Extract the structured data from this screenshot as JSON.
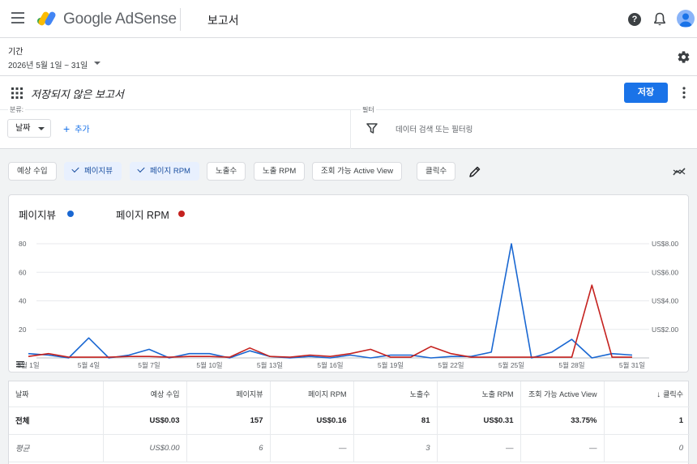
{
  "app": {
    "brand": "Google AdSense",
    "page_title": "보고서"
  },
  "period": {
    "label": "기간",
    "value": "2026년 5월 1일 ~ 31일"
  },
  "report": {
    "title": "저장되지 않은 보고서",
    "save_label": "저장",
    "dimension_label": "분류:",
    "dimension_value": "날짜",
    "add_label": "추가",
    "filter_label": "필터",
    "filter_placeholder": "데이터 검색 또는 필터링"
  },
  "metric_chips": [
    {
      "label": "예상 수입",
      "selected": false
    },
    {
      "label": "페이지뷰",
      "selected": true
    },
    {
      "label": "페이지 RPM",
      "selected": true
    },
    {
      "label": "노출수",
      "selected": false
    },
    {
      "label": "노출 RPM",
      "selected": false
    },
    {
      "label": "조회 가능 Active View",
      "selected": false
    },
    {
      "label": "클릭수",
      "selected": false
    }
  ],
  "colors": {
    "accent": "#1a73e8",
    "series_blue": "#1967d2",
    "series_red": "#c5221f"
  },
  "chart_data": {
    "type": "line",
    "x": [
      "5월 1일",
      "5월 2일",
      "5월 3일",
      "5월 4일",
      "5월 5일",
      "5월 6일",
      "5월 7일",
      "5월 8일",
      "5월 9일",
      "5월 10일",
      "5월 11일",
      "5월 12일",
      "5월 13일",
      "5월 14일",
      "5월 15일",
      "5월 16일",
      "5월 17일",
      "5월 18일",
      "5월 19일",
      "5월 20일",
      "5월 21일",
      "5월 22일",
      "5월 23일",
      "5월 24일",
      "5월 25일",
      "5월 26일",
      "5월 27일",
      "5월 28일",
      "5월 29일",
      "5월 30일",
      "5월 31일"
    ],
    "x_tick_labels": [
      "5월 1일",
      "5월 4일",
      "5월 7일",
      "5월 10일",
      "5월 13일",
      "5월 16일",
      "5월 19일",
      "5월 22일",
      "5월 25일",
      "5월 28일",
      "5월 31일"
    ],
    "series": [
      {
        "name": "페이지뷰",
        "axis": "left",
        "color": "#1967d2",
        "values": [
          3,
          2,
          0,
          14,
          0,
          2,
          6,
          0,
          3,
          3,
          0,
          5,
          1,
          0,
          1,
          0,
          2,
          0,
          2,
          2,
          0,
          1,
          1,
          4,
          80,
          0,
          4,
          13,
          0,
          3,
          2
        ]
      },
      {
        "name": "페이지 RPM",
        "axis": "right",
        "color": "#c5221f",
        "values": [
          0.1,
          0.3,
          0.05,
          0.05,
          0.05,
          0.1,
          0.1,
          0.05,
          0.1,
          0.1,
          0.05,
          0.7,
          0.1,
          0.05,
          0.2,
          0.1,
          0.3,
          0.6,
          0.05,
          0.05,
          0.8,
          0.3,
          0.05,
          0.05,
          0.05,
          0.05,
          0.05,
          0.05,
          5.1,
          0.05,
          0.05
        ]
      }
    ],
    "y_left": {
      "ticks": [
        "80",
        "60",
        "40",
        "20"
      ],
      "ylim": [
        0,
        80
      ]
    },
    "y_right": {
      "ticks": [
        "US$8.00",
        "US$6.00",
        "US$4.00",
        "US$2.00"
      ],
      "ylim": [
        0,
        8
      ]
    },
    "grid": true,
    "legend": "top-left"
  },
  "table": {
    "headers": [
      "날짜",
      "예상 수입",
      "페이지뷰",
      "페이지 RPM",
      "노출수",
      "노출 RPM",
      "조회 가능 Active View",
      "클릭수"
    ],
    "sort_column": "클릭수",
    "rows": [
      {
        "kind": "total",
        "cells": [
          "전체",
          "US$0.03",
          "157",
          "US$0.16",
          "81",
          "US$0.31",
          "33.75%",
          "1"
        ]
      },
      {
        "kind": "avg",
        "cells": [
          "평균",
          "US$0.00",
          "6",
          "—",
          "3",
          "—",
          "—",
          "0"
        ]
      }
    ]
  }
}
